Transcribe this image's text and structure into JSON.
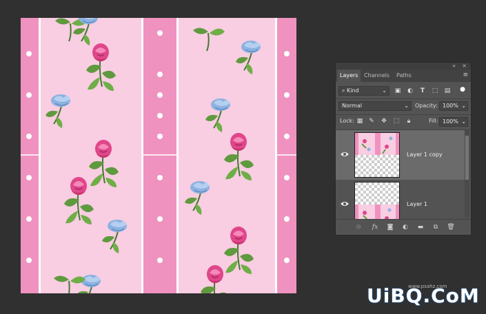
{
  "panel": {
    "top_controls": [
      "«",
      "×"
    ],
    "tabs": [
      {
        "label": "Layers",
        "active": true
      },
      {
        "label": "Channels",
        "active": false
      },
      {
        "label": "Paths",
        "active": false
      }
    ],
    "menu_icon": "panel-menu-icon",
    "filter": {
      "label": "Kind",
      "icon": "search-icon"
    },
    "blend_mode": "Normal",
    "opacity_label": "Opacity:",
    "opacity_value": "100%",
    "lock_label": "Lock:",
    "fill_label": "Fill:",
    "fill_value": "100%",
    "layers": [
      {
        "name": "Layer 1 copy",
        "visible": true,
        "selected": true
      },
      {
        "name": "Layer 1",
        "visible": true,
        "selected": false
      }
    ],
    "bottom_icons": [
      "link-icon",
      "fx-icon",
      "mask-icon",
      "adjustment-icon",
      "folder-icon",
      "new-layer-icon",
      "trash-icon"
    ],
    "fx_label": "fx"
  },
  "watermark": {
    "text": "UiBQ.CoM",
    "url": "www.psahz.com"
  },
  "colors": {
    "canvas_pink": "#f7b3d3",
    "stripe_pink": "#ef92bf",
    "panel_bg": "#535353",
    "app_bg": "#303030"
  }
}
